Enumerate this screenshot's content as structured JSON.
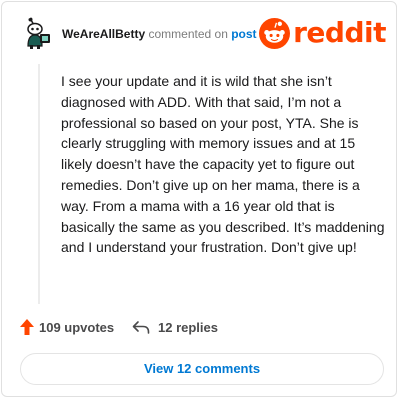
{
  "header": {
    "username": "WeAreAllBetty",
    "commented_on": "commented on",
    "post_link": "post",
    "logo_text": "reddit"
  },
  "comment": {
    "text": "I see your update and it is wild that she isn’t diagnosed with ADD. With that said, I’m not a professional so based on your post, YTA. She is clearly struggling with memory issues and at 15 likely doesn’t have the capacity yet to figure out remedies. Don’t give up on her mama, there is a way. From a mama with a 16 year old that is basically the same as you described. It’s maddening and I understand your frustration. Don’t give up!"
  },
  "actions": {
    "upvotes": "109 upvotes",
    "replies": "12 replies"
  },
  "footer": {
    "view_comments": "View 12 comments"
  },
  "colors": {
    "brand": "#ff4500",
    "link": "#0079d3",
    "upvote": "#ff4500"
  },
  "icons": {
    "avatar": "snoo-avatar-icon",
    "logo": "reddit-snoo-icon",
    "upvote": "upvote-arrow-icon",
    "reply": "reply-arrow-icon"
  }
}
